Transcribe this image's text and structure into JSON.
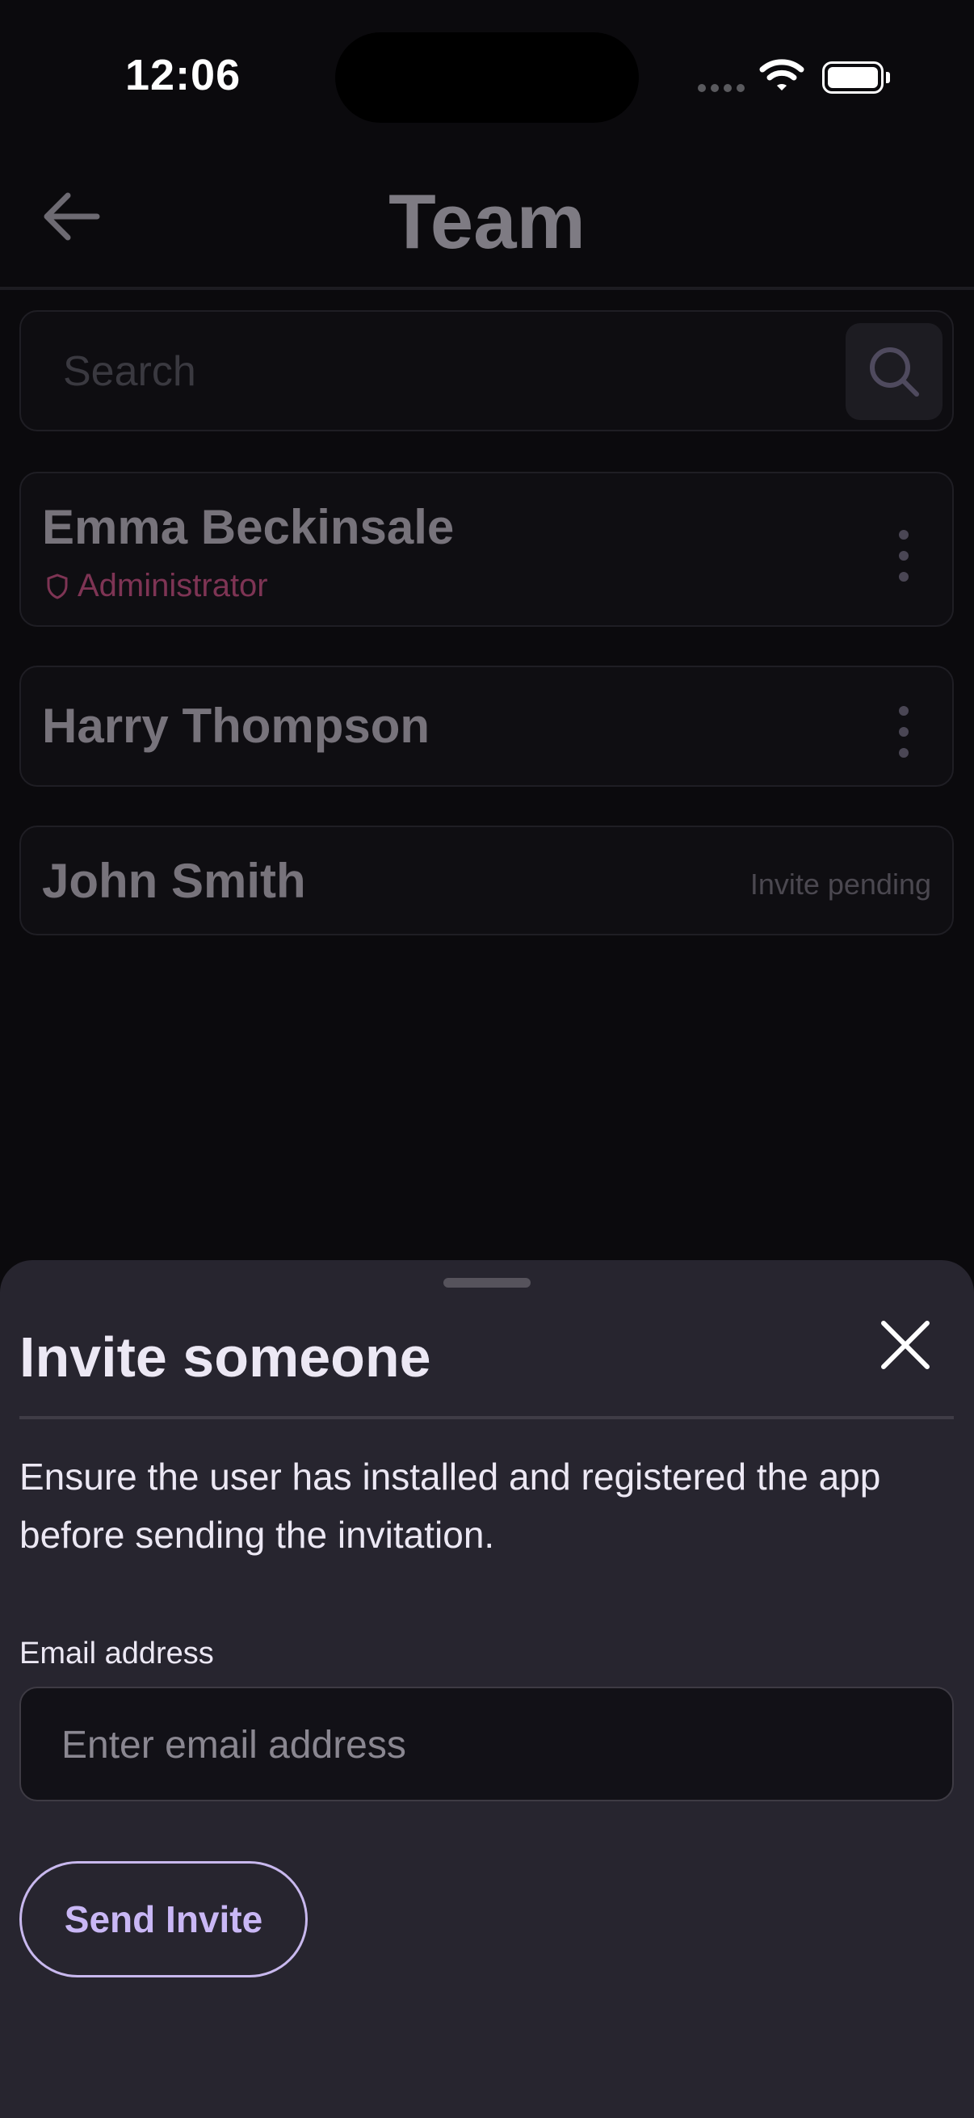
{
  "status_bar": {
    "time": "12:06"
  },
  "header": {
    "title": "Team"
  },
  "search": {
    "placeholder": "Search"
  },
  "members": [
    {
      "name": "Emma Beckinsale",
      "role": "Administrator"
    },
    {
      "name": "Harry Thompson"
    },
    {
      "name": "John Smith",
      "status": "Invite pending"
    }
  ],
  "sheet": {
    "title": "Invite someone",
    "description": "Ensure the user has installed and registered the app before sending the invitation.",
    "email_label": "Email address",
    "email_placeholder": "Enter email address",
    "send_label": "Send Invite"
  },
  "colors": {
    "accent": "#c9b7f5",
    "admin_role": "#7e3454",
    "sheet_bg": "#27252f"
  }
}
